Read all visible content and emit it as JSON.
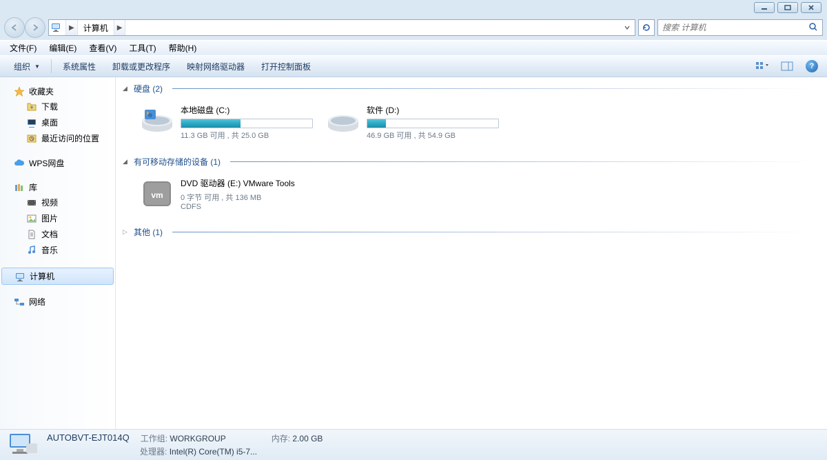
{
  "window": {
    "controls": {
      "minimize": "min",
      "maximize": "max",
      "close": "close"
    }
  },
  "breadcrumb": {
    "location": "计算机"
  },
  "search": {
    "placeholder": "搜索 计算机"
  },
  "menubar": {
    "file": "文件(F)",
    "edit": "编辑(E)",
    "view": "查看(V)",
    "tools": "工具(T)",
    "help": "帮助(H)"
  },
  "toolbar": {
    "organize": "组织",
    "properties": "系统属性",
    "uninstall": "卸载或更改程序",
    "map_drive": "映射网络驱动器",
    "control_panel": "打开控制面板"
  },
  "sidebar": {
    "favorites": {
      "label": "收藏夹"
    },
    "downloads": {
      "label": "下载"
    },
    "desktop": {
      "label": "桌面"
    },
    "recent": {
      "label": "最近访问的位置"
    },
    "wps": {
      "label": "WPS网盘"
    },
    "libraries": {
      "label": "库"
    },
    "videos": {
      "label": "视频"
    },
    "pictures": {
      "label": "图片"
    },
    "documents": {
      "label": "文档"
    },
    "music": {
      "label": "音乐"
    },
    "computer": {
      "label": "计算机"
    },
    "network": {
      "label": "网络"
    }
  },
  "sections": {
    "hdd": {
      "title": "硬盘 (2)"
    },
    "removable": {
      "title": "有可移动存储的设备 (1)"
    },
    "other": {
      "title": "其他 (1)"
    }
  },
  "drives": {
    "c": {
      "name": "本地磁盘 (C:)",
      "stats": "11.3 GB 可用 , 共 25.0 GB",
      "fill_pct": 45
    },
    "d": {
      "name": "软件 (D:)",
      "stats": "46.9 GB 可用 , 共 54.9 GB",
      "fill_pct": 14
    },
    "e": {
      "name": "DVD 驱动器 (E:) VMware Tools",
      "stats": "0 字节 可用 , 共 136 MB",
      "fs": "CDFS"
    }
  },
  "statusbar": {
    "computer_name": "AUTOBVT-EJT014Q",
    "workgroup_label": "工作组:",
    "workgroup_value": "WORKGROUP",
    "memory_label": "内存:",
    "memory_value": "2.00 GB",
    "processor_label": "处理器:",
    "processor_value": "Intel(R) Core(TM) i5-7..."
  }
}
